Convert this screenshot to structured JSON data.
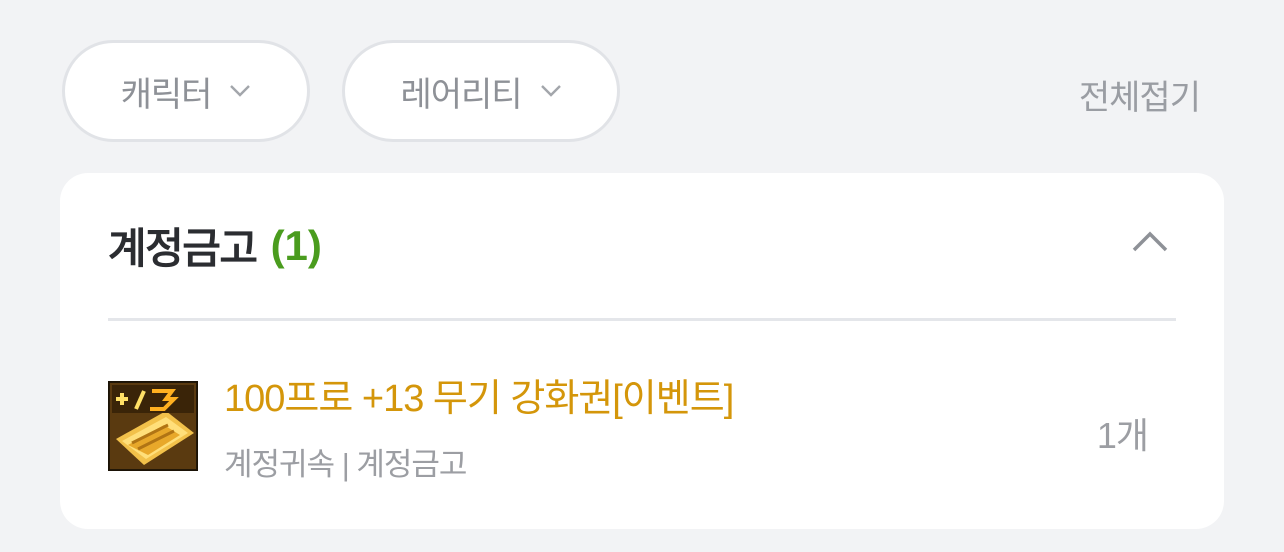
{
  "filters": {
    "character": {
      "label": "캐릭터",
      "icon": "chevron-down-icon"
    },
    "rarity": {
      "label": "레어리티",
      "icon": "chevron-down-icon"
    },
    "collapse_all_label": "전체접기"
  },
  "section": {
    "title": "계정금고",
    "count": "(1)",
    "toggle_icon": "chevron-up-icon",
    "items": [
      {
        "icon": "enhancement-scroll-icon",
        "name": "100프로 +13 무기 강화권[이벤트]",
        "meta": "계정귀속 | 계정금고",
        "quantity": "1개"
      }
    ]
  },
  "colors": {
    "background": "#f2f3f5",
    "card": "#ffffff",
    "count_green": "#4a9c1e",
    "item_name_gold": "#d4960a",
    "muted_text": "#9c9ea3"
  }
}
